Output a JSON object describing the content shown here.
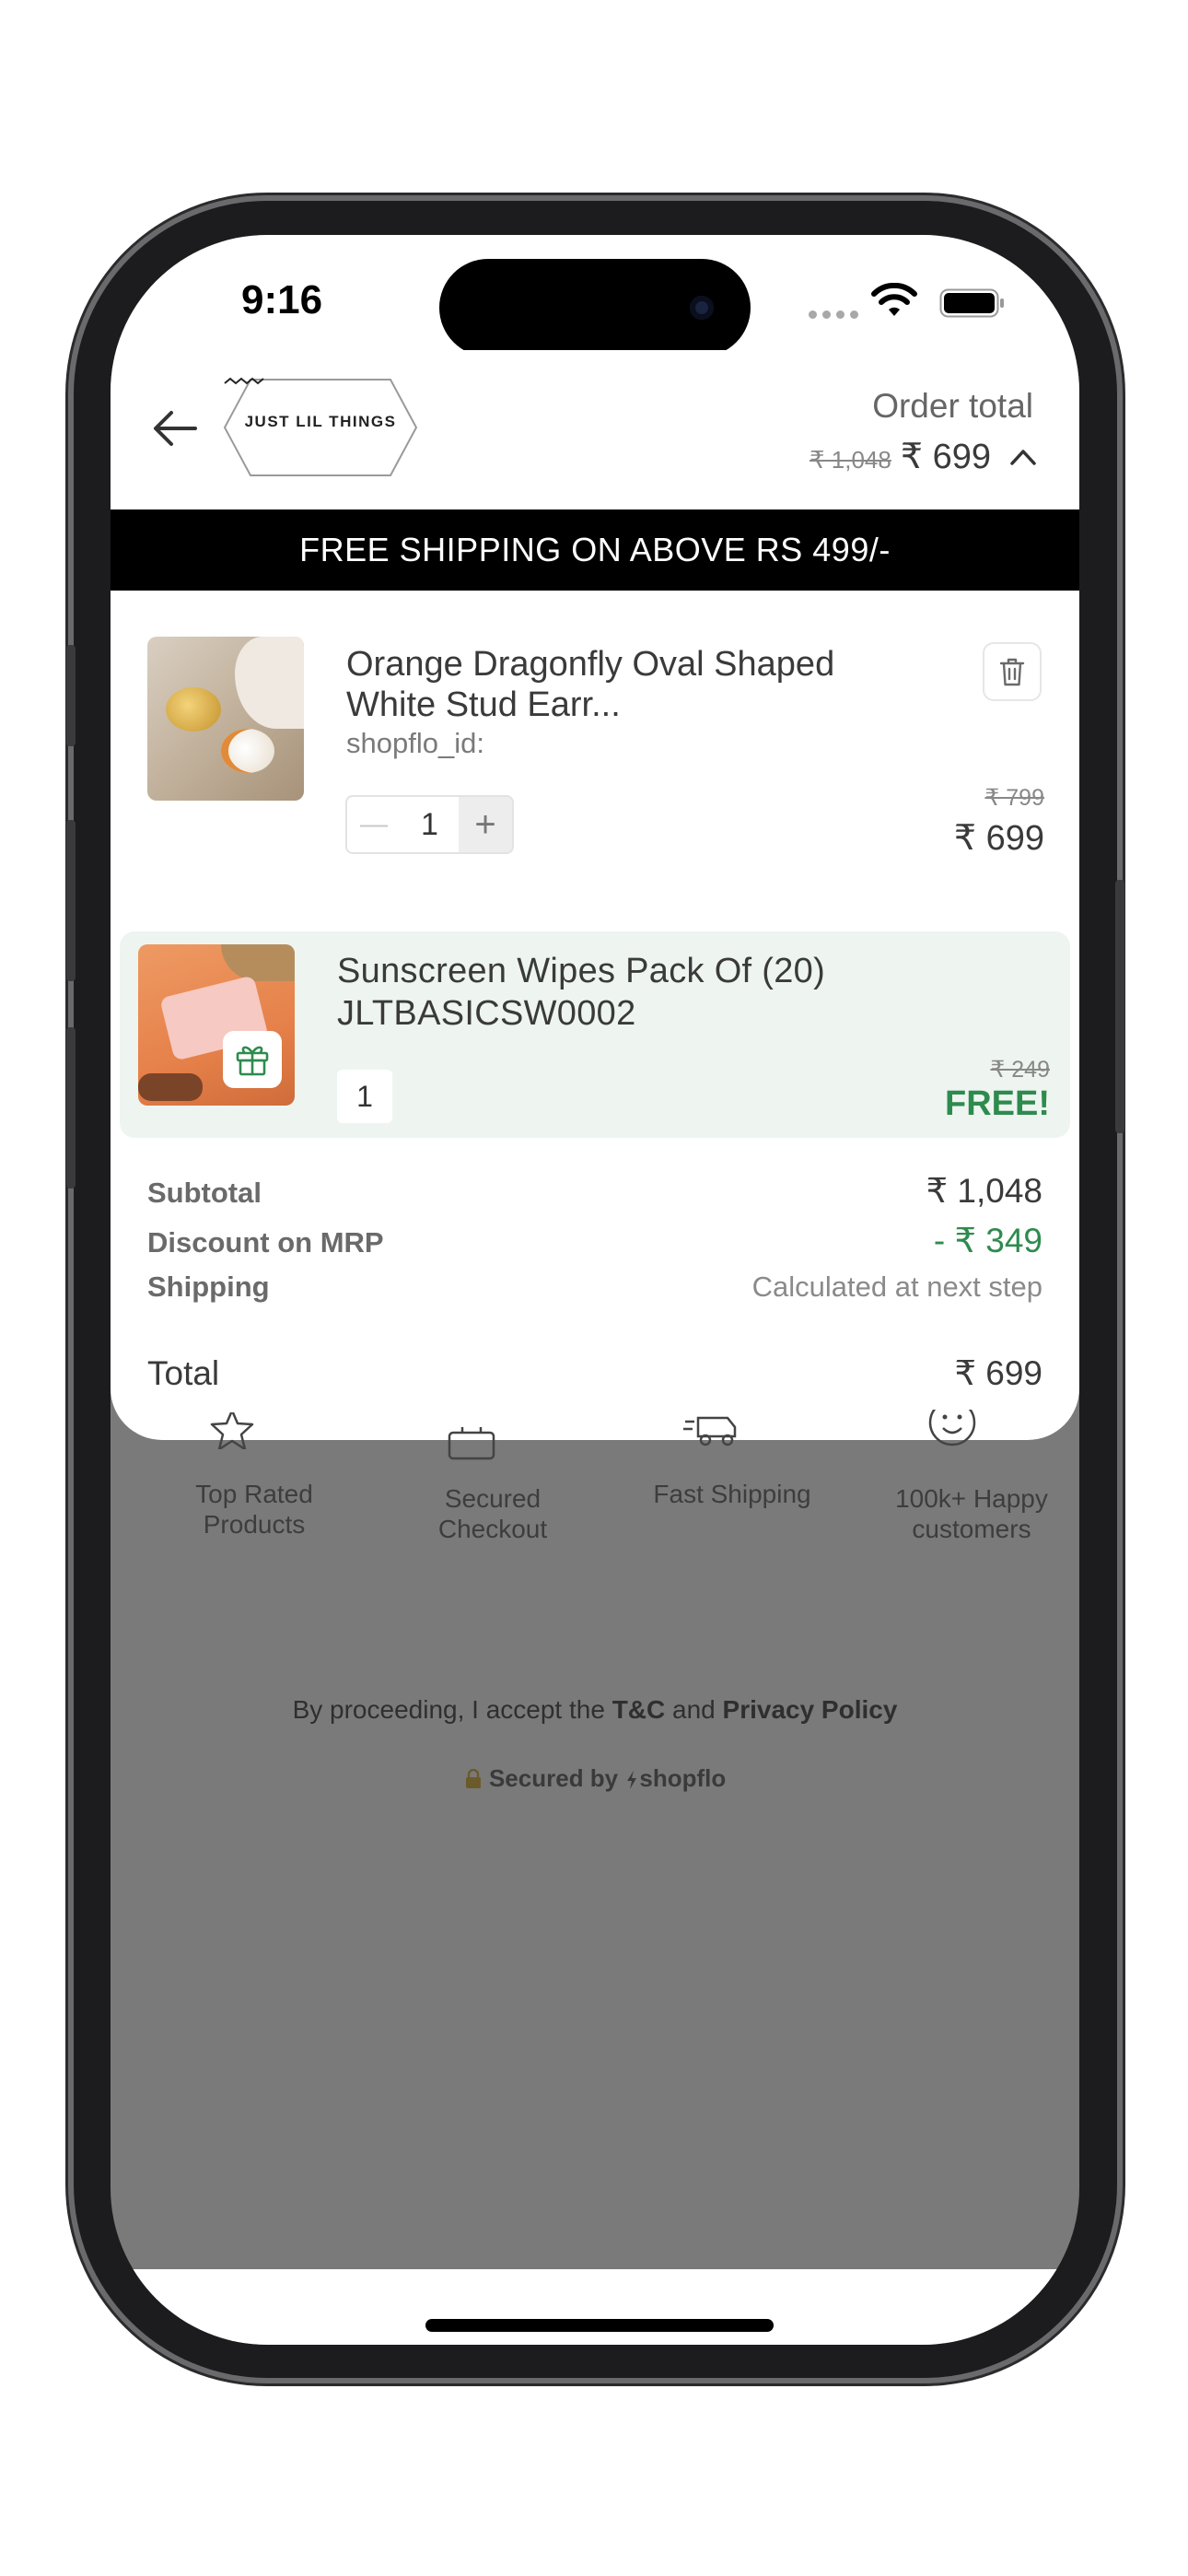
{
  "status_bar": {
    "time": "9:16"
  },
  "header": {
    "brand_name": "JUST LIL THINGS",
    "order_total_label": "Order total",
    "order_total_original": "₹ 1,048",
    "order_total_price": "₹ 699"
  },
  "banner": {
    "text": "FREE SHIPPING ON ABOVE RS 499/-"
  },
  "cart": {
    "items": [
      {
        "title": "Orange Dragonfly Oval Shaped White Stud Earr...",
        "variant": "shopflo_id:",
        "quantity": "1",
        "original_price": "₹ 799",
        "price": "₹ 699"
      }
    ],
    "gift": {
      "title_line1": "Sunscreen Wipes Pack Of (20)",
      "title_line2": "JLTBASICSW0002",
      "quantity": "1",
      "original_price": "₹ 249",
      "price": "FREE!"
    }
  },
  "summary": {
    "subtotal_label": "Subtotal",
    "subtotal_value": "₹ 1,048",
    "discount_label": "Discount on MRP",
    "discount_value": "- ₹ 349",
    "shipping_label": "Shipping",
    "shipping_value": "Calculated at next step",
    "total_label": "Total",
    "total_value": "₹ 699"
  },
  "trust_badges": [
    {
      "label": "Top Rated Products",
      "icon": "star-icon"
    },
    {
      "label": "Secured Checkout",
      "icon": "bag-icon"
    },
    {
      "label": "Fast Shipping",
      "icon": "truck-icon"
    },
    {
      "label": "100k+ Happy customers",
      "icon": "smiley-icon"
    }
  ],
  "legal": {
    "prefix": "By proceeding, I accept the ",
    "tc": "T&C",
    "and": " and ",
    "privacy": "Privacy Policy"
  },
  "secured_by": {
    "text": "Secured by",
    "brand": "shopflo"
  },
  "colors": {
    "accent_green": "#2e8b4e",
    "banner_bg": "#000000",
    "gift_bg": "#eef5f1",
    "overlay": "#7a7a7a"
  }
}
